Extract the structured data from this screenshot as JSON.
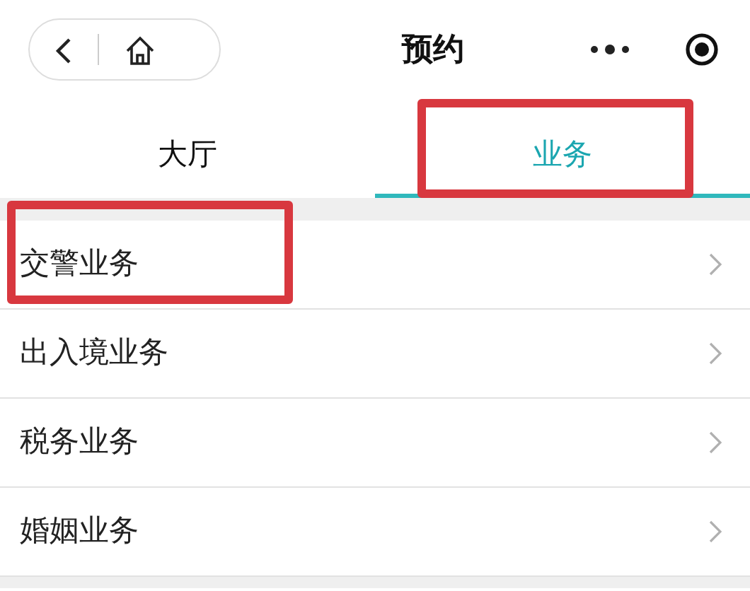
{
  "nav": {
    "title": "预约"
  },
  "tabs": [
    {
      "label": "大厅",
      "selected": false,
      "highlighted": false
    },
    {
      "label": "业务",
      "selected": true,
      "highlighted": true
    }
  ],
  "items": [
    {
      "label": "交警业务",
      "highlighted": true
    },
    {
      "label": "出入境业务",
      "highlighted": false
    },
    {
      "label": "税务业务",
      "highlighted": false
    },
    {
      "label": "婚姻业务",
      "highlighted": false
    }
  ]
}
